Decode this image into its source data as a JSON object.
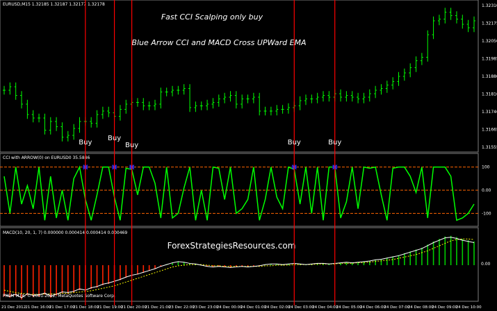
{
  "window": {
    "symbol_info": "EURUSD,M15  1.32185 1.32187 1.32177 1.32178",
    "title_line1": "Fast CCI Scalping only buy",
    "title_line2": "Blue Arrow CCI and MACD Cross UPWard EMA"
  },
  "price_scale": [
    "1.32310",
    "1.32175",
    "1.32050",
    "1.31985",
    "1.31880",
    "1.31810",
    "1.31740",
    "1.31665",
    "1.31555"
  ],
  "cci_panel": {
    "label": "CCI with ARROW(0) on EURUSD0 35.5846",
    "scale": [
      "100",
      "0.00",
      "-100"
    ]
  },
  "macd_panel": {
    "label": "MACD(10, 20, 1, 7) 0.000000 0.000414 0.000414 0.000469",
    "watermark": "ForexStrategiesResources.com",
    "scale": [
      "0.00"
    ]
  },
  "buy_signals": [
    {
      "label": "Buy"
    },
    {
      "label": "Buy"
    },
    {
      "label": "Buy"
    },
    {
      "label": "Buy"
    },
    {
      "label": "Buy"
    }
  ],
  "footer": {
    "copyright": "FXCM MT4, © 2001-2012, MetaQuotes Software Corp.",
    "time_labels": [
      "21 Dec 2012",
      "21 Dec 16:00",
      "21 Dec 17:00",
      "21 Dec 18:00",
      "21 Dec 19:00",
      "21 Dec 20:00",
      "21 Dec 21:00",
      "23 Dec 22:00",
      "23 Dec 23:00",
      "24 Dec 00:00",
      "24 Dec 01:00",
      "24 Dec 02:00",
      "24 Dec 03:00",
      "24 Dec 04:00",
      "24 Dec 05:00",
      "24 Dec 06:00",
      "24 Dec 07:00",
      "24 Dec 08:00",
      "24 Dec 09:00",
      "24 Dec 10:00"
    ]
  },
  "colors": {
    "background": "#000000",
    "candle": "#00ff00",
    "signal_line": "#ff0000",
    "cci_line": "#00ff00",
    "cci_level": "#ff6600",
    "arrow": "#3333ff",
    "macd_hist_neg": "#ff2200",
    "macd_hist_pos": "#00cc00",
    "macd_signal": "#ffff00",
    "panel_border": "#ffffff"
  },
  "chart_data": {
    "type": "line",
    "price_close": [
      1.3184,
      1.3186,
      1.3181,
      1.3176,
      1.317,
      1.3168,
      1.3168,
      1.3161,
      1.3166,
      1.3163,
      1.3157,
      1.3158,
      1.3162,
      1.3166,
      1.3166,
      1.3165,
      1.317,
      1.3172,
      1.3171,
      1.3169,
      1.3173,
      1.3176,
      1.3177,
      1.3177,
      1.3175,
      1.3175,
      1.3176,
      1.3183,
      1.3183,
      1.3184,
      1.3184,
      1.3185,
      1.3174,
      1.3175,
      1.3175,
      1.3176,
      1.3177,
      1.3179,
      1.318,
      1.3181,
      1.3176,
      1.3179,
      1.3179,
      1.318,
      1.3172,
      1.3172,
      1.3172,
      1.3173,
      1.3173,
      1.3174,
      1.3175,
      1.3178,
      1.3179,
      1.3179,
      1.318,
      1.3181,
      1.318,
      1.3182,
      1.318,
      1.3181,
      1.318,
      1.3179,
      1.318,
      1.3182,
      1.3184,
      1.3185,
      1.3187,
      1.3189,
      1.3192,
      1.3194,
      1.3197,
      1.3201,
      1.3203,
      1.3216,
      1.3224,
      1.3225,
      1.3229,
      1.3227,
      1.3225,
      1.3222,
      1.322,
      1.3224
    ],
    "cci_values": [
      60,
      -100,
      100,
      -60,
      20,
      -80,
      100,
      -130,
      60,
      -120,
      0,
      -130,
      50,
      100,
      -40,
      -130,
      -20,
      100,
      100,
      -30,
      -130,
      95,
      90,
      -20,
      100,
      100,
      30,
      -120,
      100,
      -120,
      -100,
      10,
      100,
      -130,
      0,
      -130,
      100,
      95,
      -40,
      100,
      -100,
      -80,
      -40,
      100,
      -130,
      -40,
      100,
      -30,
      -80,
      100,
      90,
      -60,
      100,
      -100,
      100,
      -130,
      100,
      100,
      -120,
      -50,
      100,
      -80,
      100,
      95,
      100,
      -20,
      -130,
      95,
      100,
      100,
      60,
      -10,
      100,
      -120,
      100,
      100,
      100,
      60,
      -130,
      -120,
      -100,
      -60
    ],
    "cci_ylim": [
      -150,
      150
    ],
    "macd_hist": [
      -50,
      -52,
      -49,
      -55,
      -48,
      -51,
      -50,
      -47,
      -52,
      -49,
      -45,
      -46,
      -44,
      -40,
      -42,
      -38,
      -36,
      -32,
      -30,
      -27,
      -24,
      -20,
      -17,
      -15,
      -12,
      -9,
      -6,
      -2,
      1,
      4,
      6,
      5,
      3,
      2,
      0,
      -2,
      -3,
      -2,
      -3,
      -4,
      -3,
      -2,
      -3,
      -2,
      -1,
      1,
      2,
      2,
      1,
      2,
      3,
      2,
      1,
      2,
      3,
      3,
      2,
      3,
      4,
      5,
      4,
      5,
      6,
      7,
      9,
      10,
      12,
      14,
      16,
      19,
      22,
      25,
      28,
      33,
      38,
      42,
      46,
      47,
      45,
      42,
      40,
      38
    ],
    "macd_signal": [
      -40,
      -42,
      -44,
      -45,
      -46,
      -47,
      -47,
      -46,
      -46,
      -46,
      -45,
      -45,
      -44,
      -43,
      -42,
      -41,
      -39,
      -37,
      -35,
      -33,
      -30,
      -27,
      -24,
      -21,
      -18,
      -15,
      -12,
      -9,
      -6,
      -3,
      -1,
      0,
      1,
      1,
      1,
      0,
      -1,
      -1,
      -2,
      -2,
      -2,
      -2,
      -2,
      -2,
      -2,
      -1,
      -1,
      0,
      0,
      0,
      1,
      1,
      1,
      1,
      2,
      2,
      2,
      2,
      3,
      3,
      3,
      4,
      4,
      5,
      6,
      7,
      8,
      9,
      11,
      13,
      15,
      17,
      20,
      23,
      27,
      31,
      35,
      39,
      41,
      42,
      42,
      41
    ],
    "buy_signal_bars": [
      14,
      19,
      22,
      50,
      57
    ],
    "cci_levels": [
      100,
      0,
      -100
    ]
  }
}
